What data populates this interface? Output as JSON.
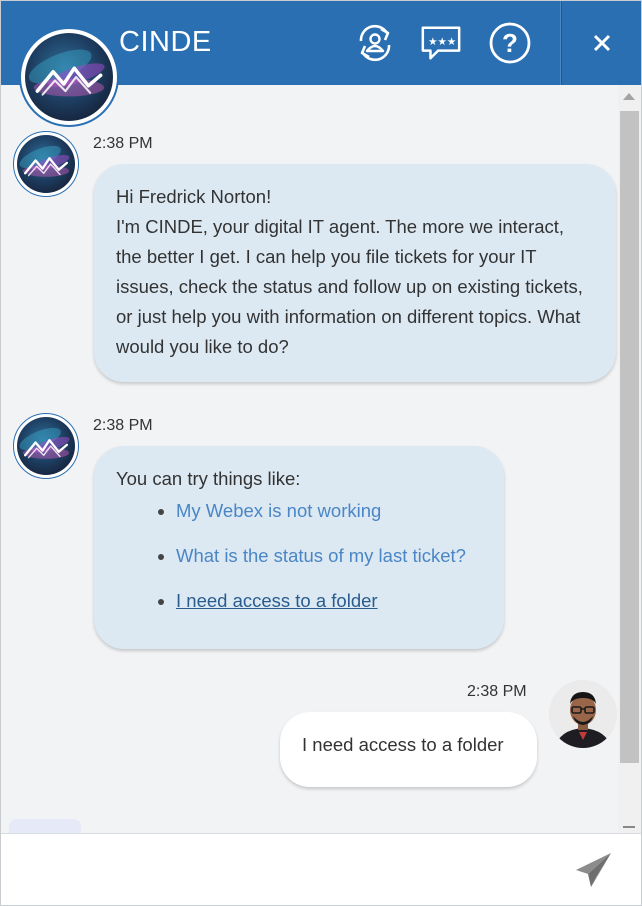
{
  "header": {
    "title": "CINDE",
    "buttons": [
      {
        "icon": "switch-agent-icon"
      },
      {
        "icon": "feedback-rating-icon"
      },
      {
        "icon": "help-icon"
      },
      {
        "icon": "close-icon"
      }
    ],
    "bg_color": "#2a6fb1"
  },
  "messages": {
    "bot_greeting": {
      "time": "2:38 PM",
      "line1": "Hi Fredrick Norton!",
      "line2": "I'm CINDE, your digital IT agent. The more we interact, the better I get. I can help you file tickets for your IT issues, check the status and follow up on existing tickets, or just help you with information on different topics. What would you like to do?"
    },
    "bot_suggestions": {
      "time": "2:38 PM",
      "intro": "You can try things like:",
      "items": [
        "My Webex is not working",
        "What is the status of my last ticket?",
        "I need access to a folder"
      ]
    },
    "user_reply": {
      "time": "2:38 PM",
      "text": "I need access to a folder"
    }
  },
  "composer": {
    "placeholder": "",
    "value": ""
  },
  "colors": {
    "bot_bubble": "#dce9f3",
    "link": "#4a86c5",
    "accent": "#2a6fb1"
  }
}
